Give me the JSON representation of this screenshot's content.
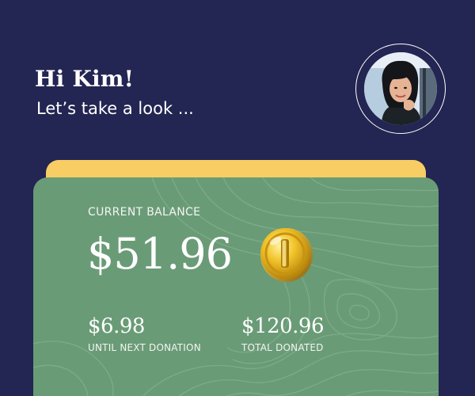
{
  "header": {
    "greeting": "Hi Kim!",
    "subtitle": "Let’s take a look ..."
  },
  "profile": {
    "avatar_alt": "Kim profile photo"
  },
  "balance_card": {
    "label": "CURRENT BALANCE",
    "amount": "$51.96",
    "coin_icon": "gold-coin-icon"
  },
  "stats": [
    {
      "value": "$6.98",
      "label": "UNTIL NEXT DONATION"
    },
    {
      "value": "$120.96",
      "label": "TOTAL DONATED"
    }
  ],
  "colors": {
    "background": "#232552",
    "card": "#6a9b77",
    "card_back": "#f7cd64",
    "coin": "#e7b81f"
  }
}
